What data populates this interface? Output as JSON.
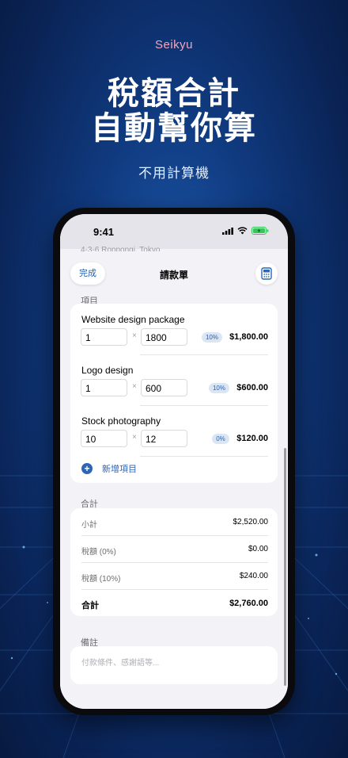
{
  "promo": {
    "brand": "Seikyu",
    "headline_line1": "稅額合計",
    "headline_line2": "自動幫你算",
    "subheadline": "不用計算機"
  },
  "status_bar": {
    "time": "9:41"
  },
  "background_text": "4-3-6 Roppongi, Tokyo",
  "nav": {
    "done_label": "完成",
    "title": "請款單",
    "calculator_icon": "calculator-icon"
  },
  "items_section": {
    "label": "項目",
    "items": [
      {
        "name": "Website design package",
        "quantity": "1",
        "price": "1800",
        "tax": "10%",
        "amount": "$1,800.00"
      },
      {
        "name": "Logo design",
        "quantity": "1",
        "price": "600",
        "tax": "10%",
        "amount": "$600.00"
      },
      {
        "name": "Stock photography",
        "quantity": "10",
        "price": "12",
        "tax": "0%",
        "amount": "$120.00"
      }
    ],
    "times_symbol": "×",
    "add_label": "新增項目"
  },
  "totals_section": {
    "label": "合計",
    "rows": [
      {
        "label": "小計",
        "value": "$2,520.00"
      },
      {
        "label": "稅額 (0%)",
        "value": "$0.00"
      },
      {
        "label": "稅額 (10%)",
        "value": "$240.00"
      },
      {
        "label": "合計",
        "value": "$2,760.00"
      }
    ]
  },
  "notes_section": {
    "label": "備註",
    "placeholder": "付款條件、感謝語等..."
  },
  "colors": {
    "accent": "#2c66b4",
    "brand_pink": "#f0a7c0",
    "background_blue": "#103a7f"
  }
}
